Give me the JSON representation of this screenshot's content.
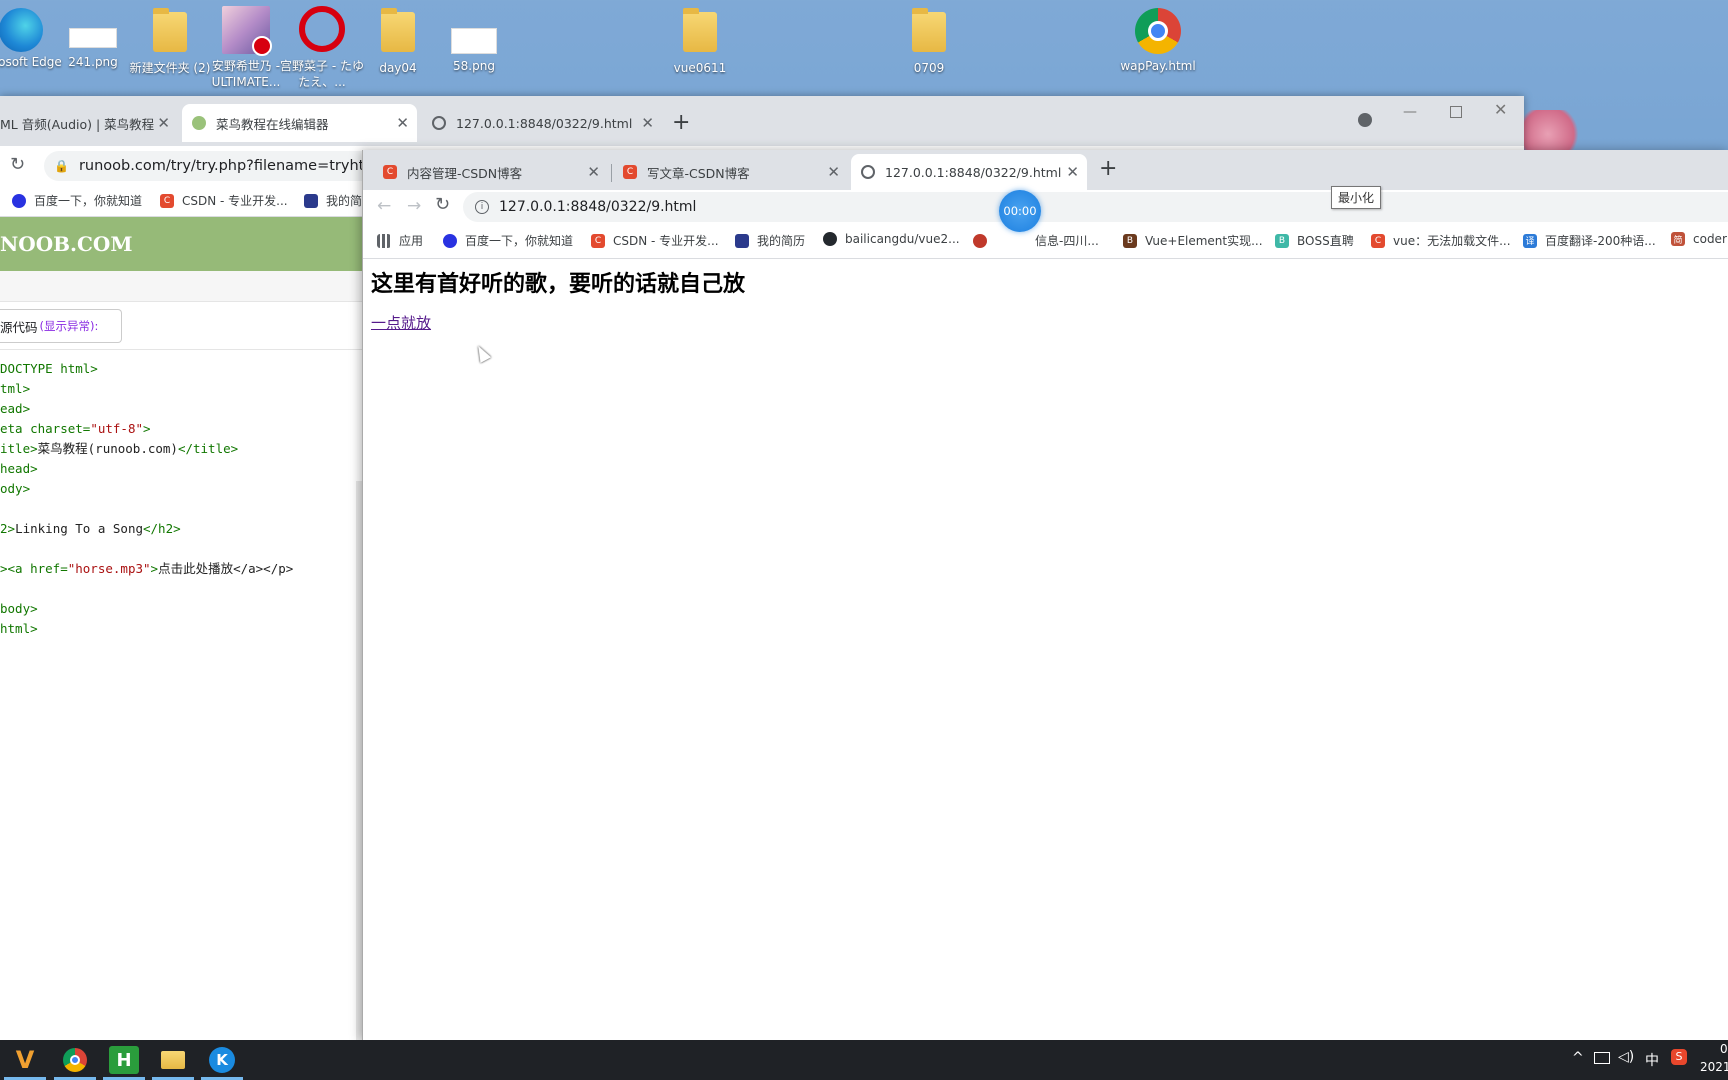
{
  "desktop": {
    "icons": [
      {
        "label": "licrosoft Edge",
        "icon": "edge-icon"
      },
      {
        "label": "241.png",
        "icon": "image-file-icon"
      },
      {
        "label": "新建文件夹 (2)",
        "icon": "folder-icon"
      },
      {
        "label": "安野希世乃 - ULTIMATE...",
        "icon": "music-file-icon"
      },
      {
        "label": "宫野菜子 - たゆたえ、...",
        "icon": "netease-music-icon"
      },
      {
        "label": "day04",
        "icon": "folder-icon"
      },
      {
        "label": "58.png",
        "icon": "image-file-icon"
      },
      {
        "label": "vue0611",
        "icon": "folder-icon"
      },
      {
        "label": "0709",
        "icon": "folder-icon"
      },
      {
        "label": "wapPay.html",
        "icon": "chrome-icon"
      }
    ]
  },
  "back_browser": {
    "tabs": [
      {
        "label": "ML 音频(Audio) | 菜鸟教程"
      },
      {
        "label": "菜鸟教程在线编辑器"
      },
      {
        "label": "127.0.0.1:8848/0322/9.html"
      }
    ],
    "url": "runoob.com/try/try.php?filename=tryhtml",
    "bookmarks": [
      "百度一下，你就知道",
      "CSDN - 专业开发...",
      "我的简"
    ],
    "site_title": "NOOB.COM",
    "source_label": "源代码",
    "source_label_hint": "(显示异常):",
    "code_lines": [
      {
        "a": "DOCTYPE html>",
        "b": "",
        "c": "",
        "d": ""
      },
      {
        "a": "tml>",
        "b": "",
        "c": "",
        "d": ""
      },
      {
        "a": "ead>",
        "b": "",
        "c": "",
        "d": ""
      },
      {
        "a": "eta charset=",
        "b": "\"utf-8\"",
        "c": ">",
        "d": ""
      },
      {
        "a": "itle>",
        "b": "菜鸟教程(runoob.com)",
        "c": "</title>",
        "d": ""
      },
      {
        "a": "head>",
        "b": "",
        "c": "",
        "d": ""
      },
      {
        "a": "ody>",
        "b": "",
        "c": "",
        "d": ""
      },
      {
        "a": "",
        "b": "",
        "c": "",
        "d": ""
      },
      {
        "a": "2>",
        "b": "Linking To a Song",
        "c": "</h2>",
        "d": ""
      },
      {
        "a": "",
        "b": "",
        "c": "",
        "d": ""
      },
      {
        "a": "><a href=",
        "b": "\"horse.mp3\"",
        "c": ">",
        "d": "点击此处播放</a></p>"
      },
      {
        "a": "",
        "b": "",
        "c": "",
        "d": ""
      },
      {
        "a": "body>",
        "b": "",
        "c": "",
        "d": ""
      },
      {
        "a": "html>",
        "b": "",
        "c": "",
        "d": ""
      }
    ]
  },
  "front_browser": {
    "tabs": [
      {
        "label": "内容管理-CSDN博客"
      },
      {
        "label": "写文章-CSDN博客"
      },
      {
        "label": "127.0.0.1:8848/0322/9.html"
      }
    ],
    "url": "127.0.0.1:8848/0322/9.html",
    "bookmarks": [
      {
        "label": "应用",
        "icon": "apps-grid-icon"
      },
      {
        "label": "百度一下，你就知道",
        "icon": "baidu-icon"
      },
      {
        "label": "CSDN - 专业开发...",
        "icon": "csdn-icon"
      },
      {
        "label": "我的简历",
        "icon": "resume-icon"
      },
      {
        "label": "bailicangdu/vue2...",
        "icon": "github-icon"
      },
      {
        "label": "信息-四川...",
        "icon": "red-icon"
      },
      {
        "label": "Vue+Element实现...",
        "icon": "b-icon"
      },
      {
        "label": "BOSS直聘",
        "icon": "boss-icon"
      },
      {
        "label": "vue：无法加载文件...",
        "icon": "csdn-icon"
      },
      {
        "label": "百度翻译-200种语...",
        "icon": "translate-icon"
      },
      {
        "label": "coder",
        "icon": "jianshu-icon"
      }
    ],
    "tooltip": "最小化",
    "timer": "00:00",
    "page": {
      "heading": "这里有首好听的歌，要听的话就自己放",
      "link": "一点就放"
    }
  },
  "taskbar": {
    "tray_ime": "中",
    "clock_time": "0",
    "clock_date": "2021"
  }
}
